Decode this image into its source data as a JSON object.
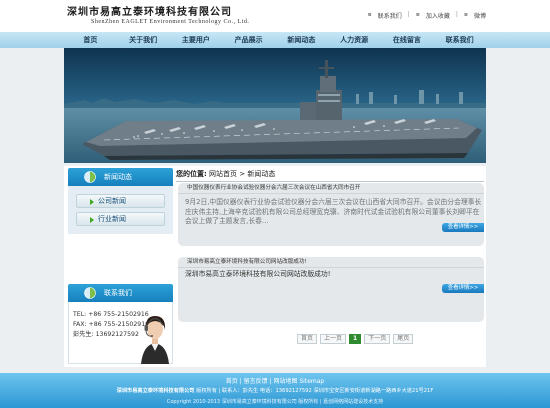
{
  "header": {
    "company_cn": "深圳市易高立泰环境科技有限公司",
    "company_en": "ShenZhen EAGLET Environment Technology Co., Ltd.",
    "links": [
      "联系我们",
      "加入收藏",
      "微博"
    ]
  },
  "nav": {
    "items": [
      "首页",
      "关于我们",
      "主要用户",
      "产品展示",
      "新闻动态",
      "人力资源",
      "在线留言",
      "联系我们"
    ]
  },
  "banner": {
    "icon": "aircraft-carrier-banner-image"
  },
  "sidebar": {
    "news_box": {
      "title": "新闻动态",
      "items": [
        "公司新闻",
        "行业新闻"
      ]
    },
    "contact_box": {
      "title": "联系我们",
      "tel": "TEL: +86 755-21502916",
      "fax": "FAX: +86 755-21502916",
      "person": "彭先生: 13692127592"
    }
  },
  "main": {
    "breadcrumb": {
      "label": "您的位置:",
      "home": "网站首页",
      "separator": ">",
      "current": "新闻动态"
    },
    "news": [
      {
        "title": "中国仪器仪表行业协会试验仪器分会六届三次会议在山西省大同市召开",
        "summary": "9月2日,中国仪器仪表行业协会试验仪器分会六届三次会议在山西省大同市召开。会议由分会理事长庄庆伟主持,上海辛克试验机有限公司总经理宽克骥、济南时代试金试验机有限公司董事长刘卿平在会议上做了主题发言,长春…",
        "more": "查看详情>>"
      },
      {
        "title": "深圳市易高立泰环境科技有限公司网站改版成功!",
        "summary": "深圳市易高立泰环境科技有限公司网站改版成功!",
        "more": "查看详情>>"
      }
    ],
    "pager": {
      "first": "首页",
      "prev": "上一页",
      "current": "1",
      "next": "下一页",
      "last": "尾页"
    }
  },
  "footer": {
    "links_line": "首页 | 留言反馈 | 网站地图 Sitemap",
    "company": "深圳市易高立泰环境科技有限公司",
    "info_line": "版权所有 | 联系人：彭先生 电话：13692127592 深圳市宝安区新安街道新湖路一路西乡大道21号21F",
    "copyright": "Copyright 2010-2013 深圳市易高立泰环境科技有限公司 版权所有 | 嘉创网络网站建设技术支持"
  },
  "colors": {
    "nav_bg": "#9fd1ea",
    "side_head": "#167fbd",
    "more_button": "#1978bd",
    "pager_current": "#2e8a2e",
    "footer_bg": "#2c97d3"
  }
}
